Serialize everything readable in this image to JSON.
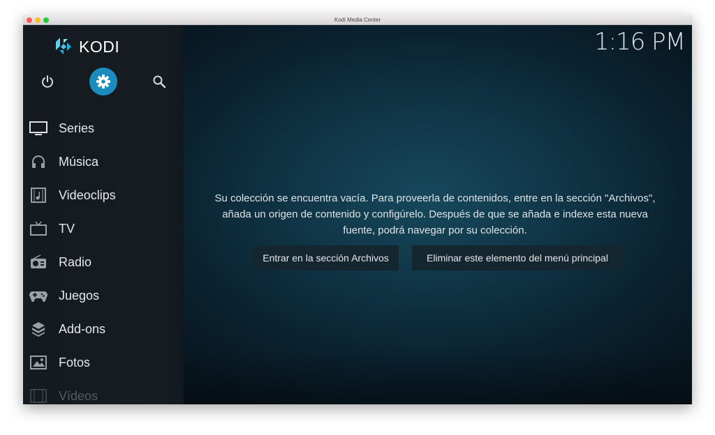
{
  "window": {
    "title": "Kodi Media Center"
  },
  "app": {
    "logo_text": "KODI",
    "clock": "1:16 PM"
  },
  "top_icons": [
    {
      "name": "power-icon"
    },
    {
      "name": "settings-icon",
      "active": true
    },
    {
      "name": "search-icon"
    }
  ],
  "sidebar": {
    "items": [
      {
        "label": "Series",
        "icon": "tv-series-icon"
      },
      {
        "label": "Música",
        "icon": "headphones-icon"
      },
      {
        "label": "Videoclips",
        "icon": "music-video-icon"
      },
      {
        "label": "TV",
        "icon": "tv-icon"
      },
      {
        "label": "Radio",
        "icon": "radio-icon"
      },
      {
        "label": "Juegos",
        "icon": "gamepad-icon"
      },
      {
        "label": "Add-ons",
        "icon": "addons-box-icon"
      },
      {
        "label": "Fotos",
        "icon": "pictures-icon"
      },
      {
        "label": "Vídeos",
        "icon": "film-icon"
      }
    ]
  },
  "main": {
    "message_lines": [
      "Su colección se encuentra vacía. Para proveerla de contenidos, entre en la sección \"Archivos\",",
      "añada un origen de contenido y configúrelo. Después de que se añada e indexe esta nueva",
      "fuente, podrá navegar por su colección."
    ],
    "buttons": [
      {
        "label": "Entrar en la sección Archivos"
      },
      {
        "label": "Eliminar este elemento del menú principal"
      }
    ]
  },
  "colors": {
    "accent": "#1c8cbf",
    "sidebar_bg": "#161d22",
    "main_bg": "#103546",
    "button_bg": "#14262f"
  }
}
